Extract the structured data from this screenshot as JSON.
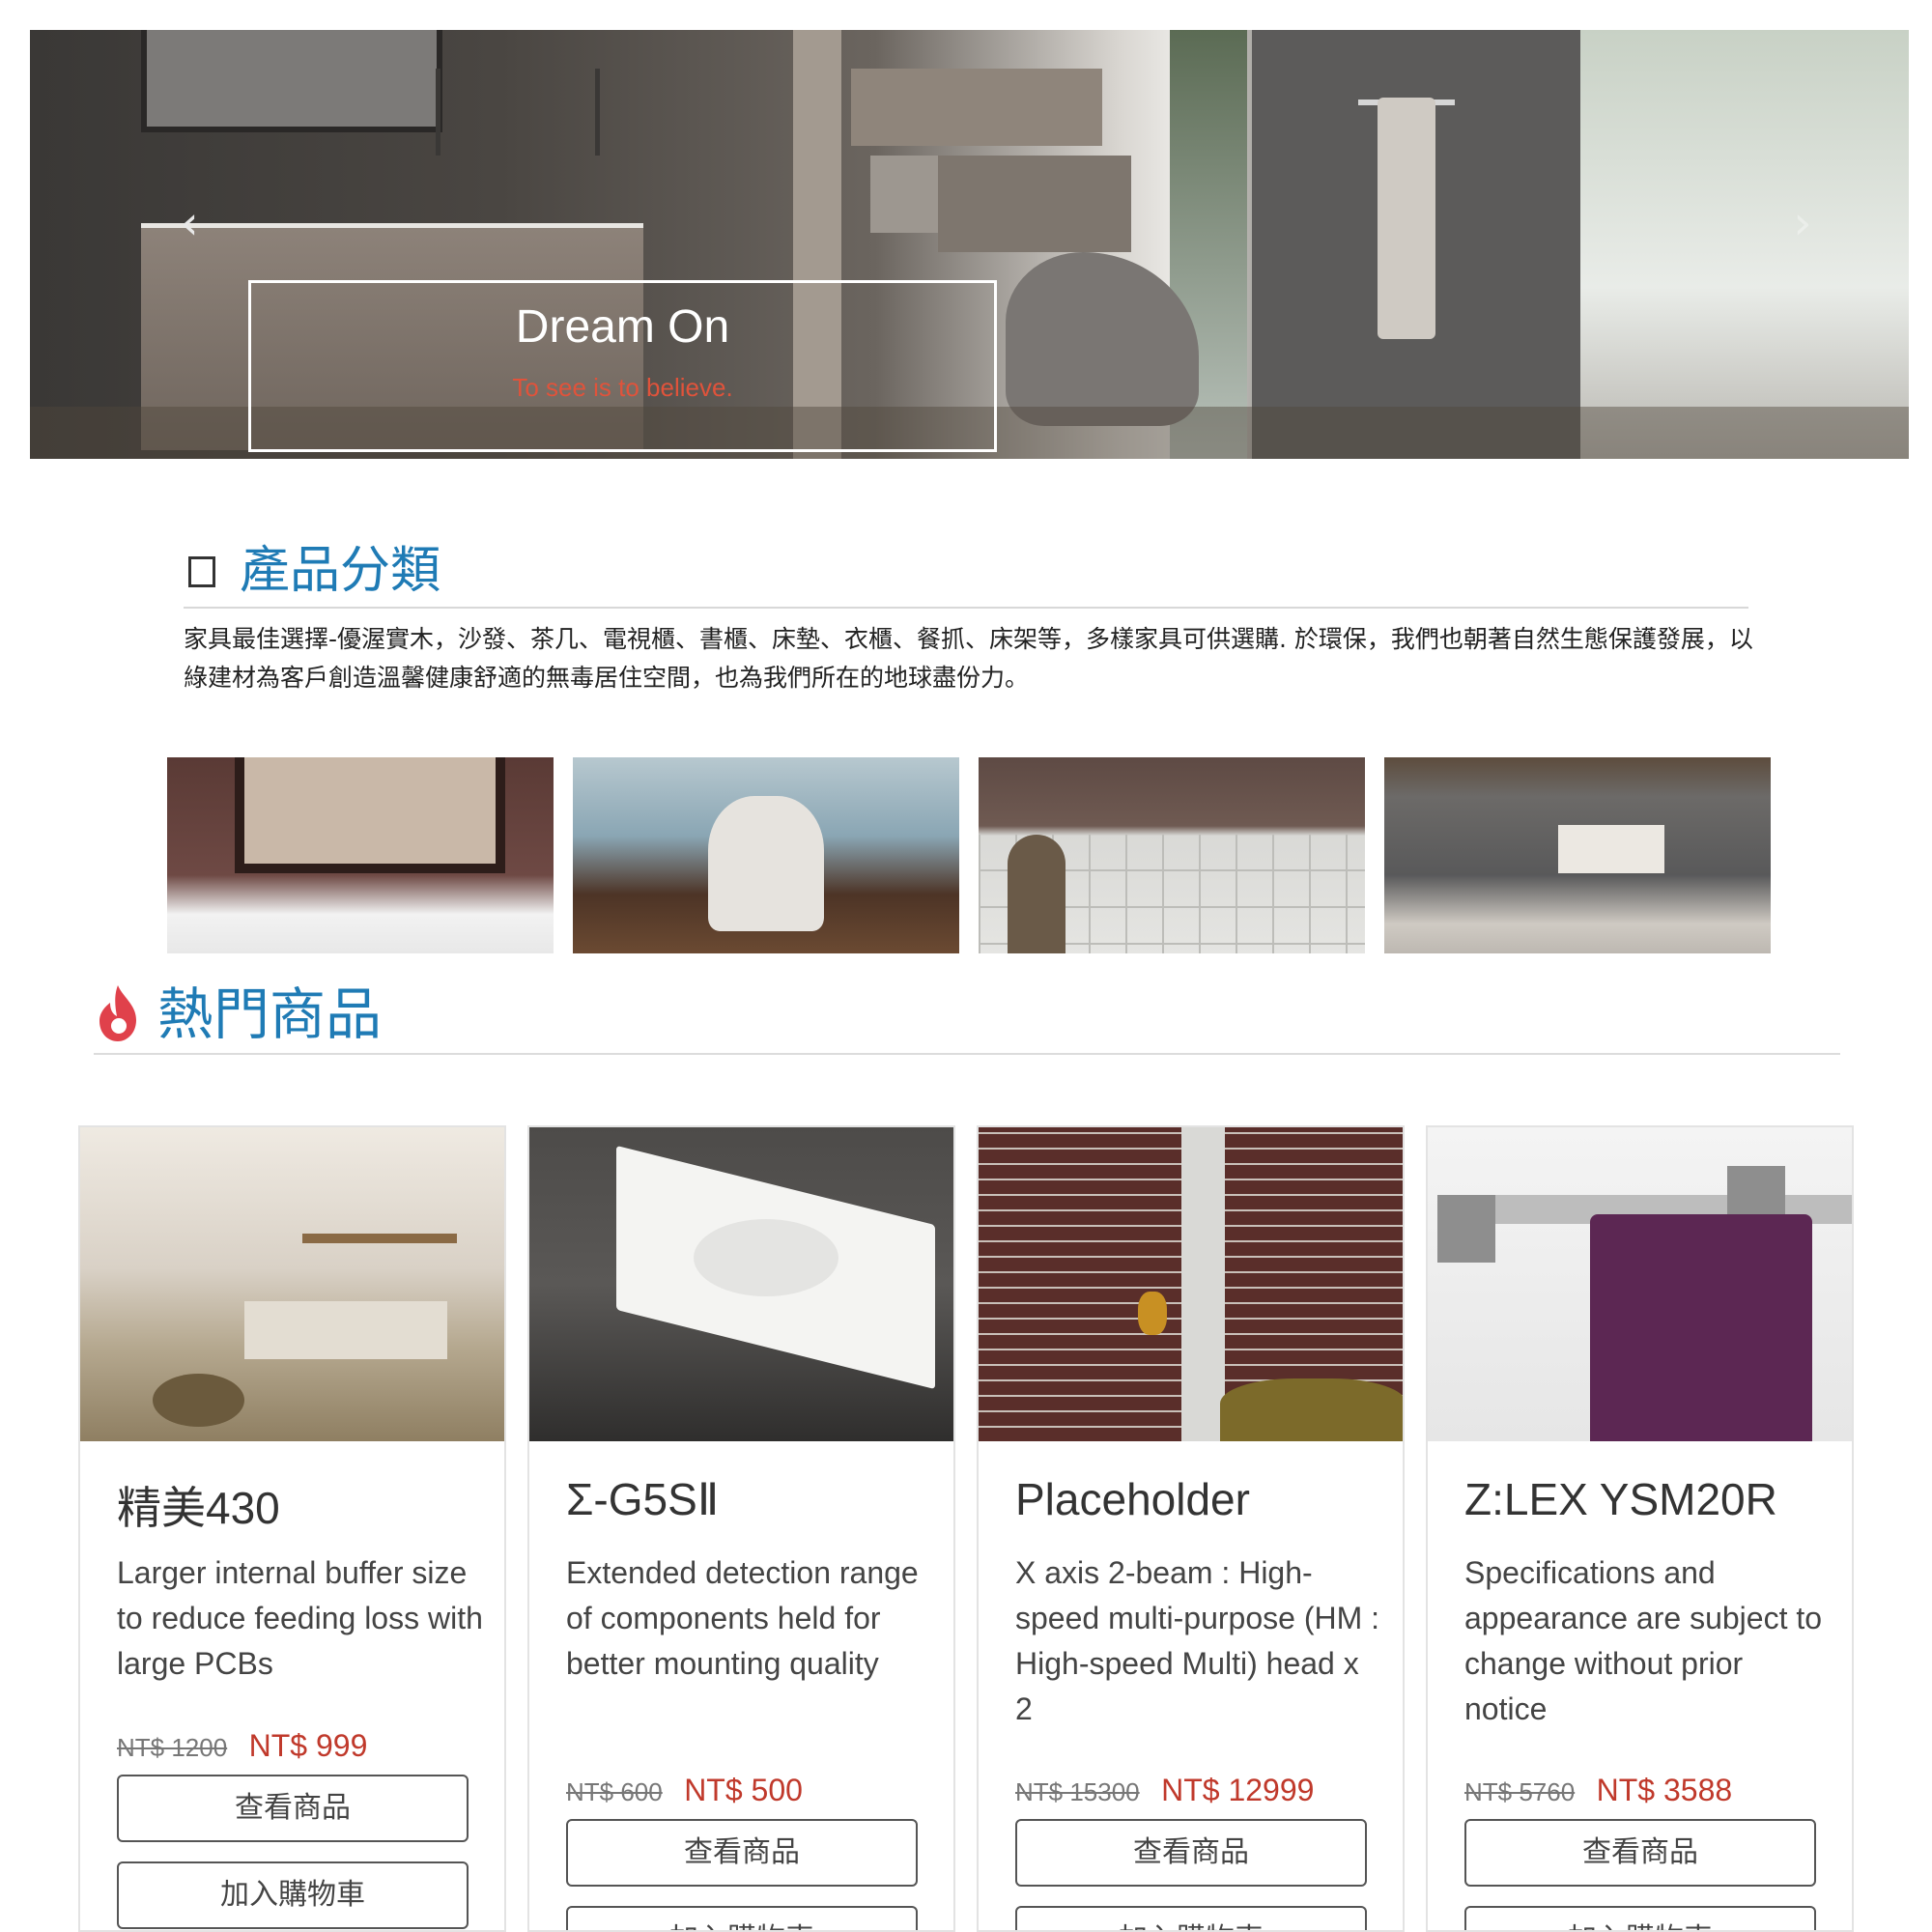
{
  "hero": {
    "caption_title": "Dream On",
    "caption_subtitle": "To see is to believe.",
    "prev_icon": "‹",
    "next_icon": "›"
  },
  "categories": {
    "heading": "產品分類",
    "description": "家具最佳選擇-優渥實木，沙發、茶几、電視櫃、書櫃、床墊、衣櫃、餐抓、床架等，多樣家具可供選購. 於環保，我們也朝著自然生態保護發展，以綠建材為客戶創造溫馨健康舒適的無毒居住空間，也為我們所在的地球盡份力。"
  },
  "hot": {
    "heading": "熱門商品"
  },
  "products": [
    {
      "name": "精美430",
      "description": "Larger internal buffer size to reduce feeding loss with large PCBs",
      "old_price": "NT$ 1200",
      "price": "NT$ 999",
      "view_label": "查看商品",
      "cart_label": "加入購物車"
    },
    {
      "name": "Σ-G5SⅡ",
      "description": "Extended detection range of components held for better mounting quality",
      "old_price": "NT$ 600",
      "price": "NT$ 500",
      "view_label": "查看商品",
      "cart_label": "加入購物車"
    },
    {
      "name": "Placeholder",
      "description": "X axis 2-beam : High-speed multi-purpose (HM : High-speed Multi) head x 2",
      "old_price": "NT$ 15300",
      "price": "NT$ 12999",
      "view_label": "查看商品",
      "cart_label": "加入購物車"
    },
    {
      "name": "Z:LEX YSM20R",
      "description": "Specifications and appearance are subject to change without prior notice",
      "old_price": "NT$ 5760",
      "price": "NT$ 3588",
      "view_label": "查看商品",
      "cart_label": "加入購物車"
    }
  ],
  "colors": {
    "heading_blue": "#1f7bb5",
    "price_red": "#c0392b",
    "fire_red": "#e0414b"
  }
}
